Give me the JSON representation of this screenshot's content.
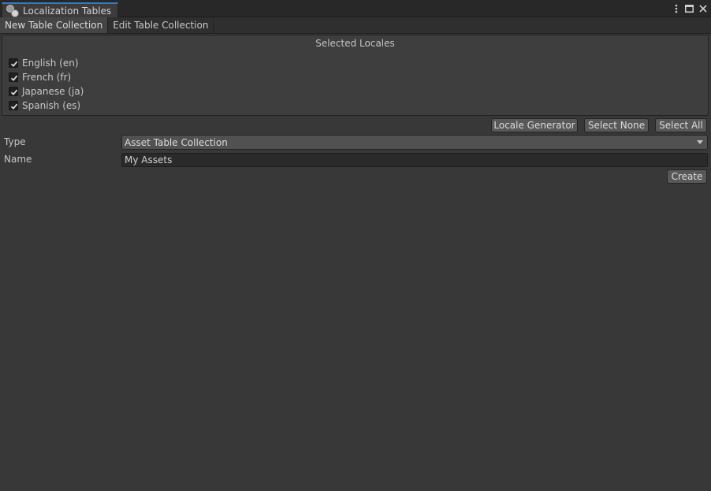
{
  "window": {
    "title": "Localization Tables",
    "controls": [
      "more-icon",
      "maximize-icon",
      "close-icon"
    ]
  },
  "tabs": [
    {
      "label": "New Table Collection",
      "active": true
    },
    {
      "label": "Edit Table Collection",
      "active": false
    }
  ],
  "locales": {
    "header": "Selected Locales",
    "items": [
      {
        "label": "English (en)",
        "checked": true
      },
      {
        "label": "French (fr)",
        "checked": true
      },
      {
        "label": "Japanese (ja)",
        "checked": true
      },
      {
        "label": "Spanish (es)",
        "checked": true
      }
    ]
  },
  "buttons": {
    "locale_generator": "Locale Generator",
    "select_none": "Select None",
    "select_all": "Select All",
    "create": "Create"
  },
  "form": {
    "type_label": "Type",
    "type_value": "Asset Table Collection",
    "name_label": "Name",
    "name_value": "My Assets"
  },
  "colors": {
    "accent": "#3a79bb",
    "background": "#383838"
  }
}
